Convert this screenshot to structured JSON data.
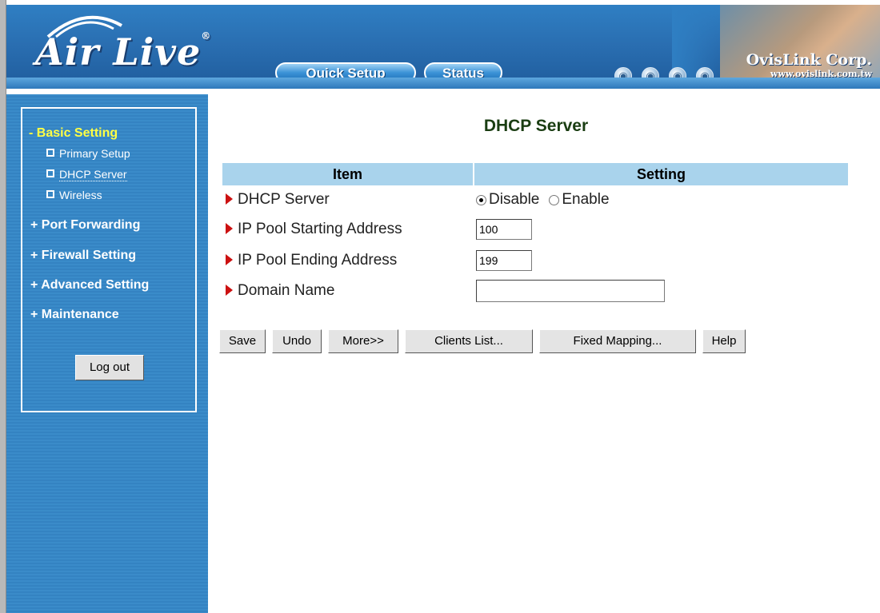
{
  "header": {
    "logo": "Air Live",
    "logo_reg": "®",
    "quick_setup": "Quick Setup",
    "status": "Status",
    "brand_name": "OvisLink Corp.",
    "brand_url": "www.ovislink.com.tw"
  },
  "sidebar": {
    "basic_setting": "- Basic Setting",
    "primary_setup": "Primary Setup",
    "dhcp_server": "DHCP Server",
    "wireless": "Wireless",
    "port_forwarding": "+ Port Forwarding",
    "firewall_setting": "+ Firewall Setting",
    "advanced_setting": "+ Advanced Setting",
    "maintenance": "+ Maintenance",
    "logout": "Log out"
  },
  "main": {
    "title": "DHCP Server",
    "col_item": "Item",
    "col_setting": "Setting",
    "rows": {
      "dhcp_server": {
        "label": "DHCP Server",
        "option_disable": "Disable",
        "option_enable": "Enable",
        "selected": "Disable"
      },
      "pool_start": {
        "label": "IP Pool Starting Address",
        "value": "100"
      },
      "pool_end": {
        "label": "IP Pool Ending Address",
        "value": "199"
      },
      "domain": {
        "label": "Domain Name",
        "value": ""
      }
    },
    "buttons": {
      "save": "Save",
      "undo": "Undo",
      "more": "More>>",
      "clients_list": "Clients List...",
      "fixed_mapping": "Fixed Mapping...",
      "help": "Help"
    }
  },
  "colors": {
    "header_blue": "#2f7fc3",
    "sidebar_blue": "#3a8bc9",
    "table_header": "#a9d3ec",
    "active_nav": "#ffff44",
    "title_green": "#1a3d12",
    "arrow_red": "#cc1111"
  },
  "icons": [
    "globe-icon",
    "globe-icon",
    "globe-icon",
    "globe-icon",
    "arrow-right-icon",
    "square-bullet-icon"
  ]
}
